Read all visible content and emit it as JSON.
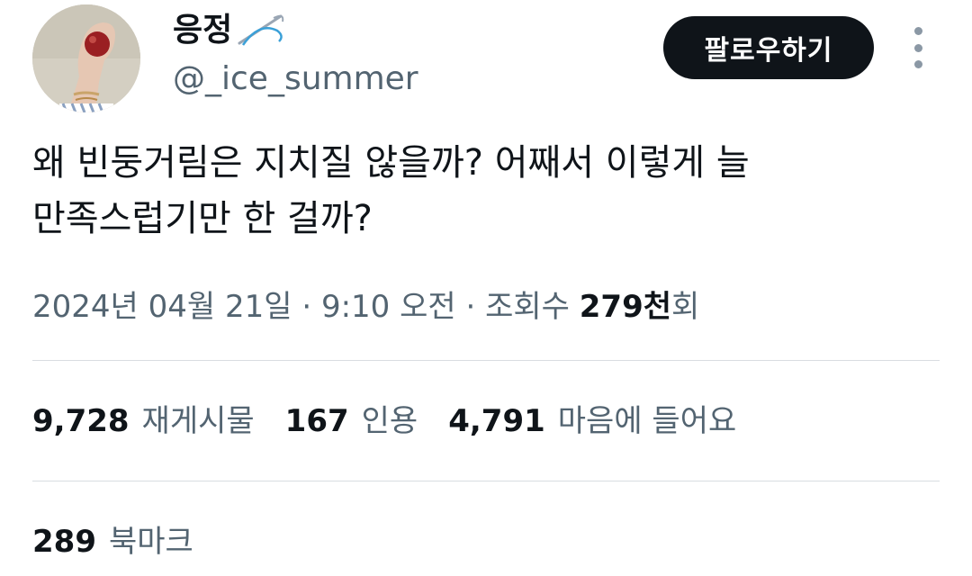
{
  "author": {
    "display_name": "응정",
    "handle": "@_ice_summer",
    "name_emoji_icon": "sewing-needle-icon"
  },
  "header": {
    "follow_label": "팔로우하기",
    "more_icon": "vertical-ellipsis-icon"
  },
  "tweet": {
    "text_lines": [
      "왜 빈둥거림은 지치질 않을까? 어째서 이렇게 늘",
      "만족스럽기만 한 걸까?"
    ]
  },
  "meta": {
    "date": "2024년 04월 21일",
    "separator": " · ",
    "time": "9:10 오전",
    "views_label": "조회수",
    "views_count": "279천",
    "views_suffix": "회"
  },
  "stats": [
    {
      "count": "9,728",
      "label": "재게시물"
    },
    {
      "count": "167",
      "label": "인용"
    },
    {
      "count": "4,791",
      "label": "마음에 들어요"
    }
  ],
  "bookmarks": {
    "count": "289",
    "label": "북마크"
  },
  "colors": {
    "text_primary": "#0f1419",
    "text_secondary": "#536471",
    "divider": "#d9dde1",
    "follow_bg": "#0f1419",
    "follow_text": "#ffffff"
  }
}
